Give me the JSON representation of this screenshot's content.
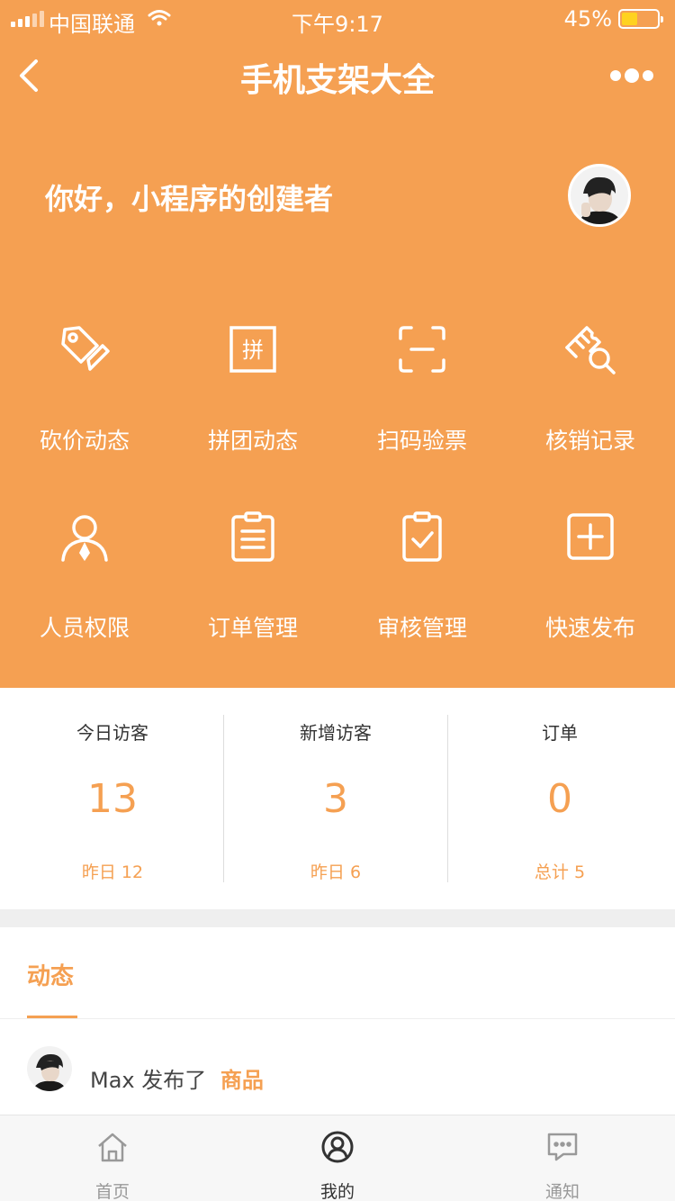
{
  "status_bar": {
    "carrier": "中国联通",
    "time": "下午9:17",
    "battery": "45%",
    "battery_level": 0.45
  },
  "nav": {
    "title": "手机支架大全"
  },
  "greeting": "你好，小程序的创建者",
  "grid": [
    {
      "label": "砍价动态",
      "icon": "tag-icon"
    },
    {
      "label": "拼团动态",
      "icon": "group-buy-icon"
    },
    {
      "label": "扫码验票",
      "icon": "scan-icon"
    },
    {
      "label": "核销记录",
      "icon": "ticket-search-icon"
    },
    {
      "label": "人员权限",
      "icon": "person-icon"
    },
    {
      "label": "订单管理",
      "icon": "order-list-icon"
    },
    {
      "label": "审核管理",
      "icon": "clipboard-check-icon"
    },
    {
      "label": "快速发布",
      "icon": "add-square-icon"
    }
  ],
  "stats": [
    {
      "label": "今日访客",
      "value": "13",
      "sub": "昨日 12"
    },
    {
      "label": "新增访客",
      "value": "3",
      "sub": "昨日 6"
    },
    {
      "label": "订单",
      "value": "0",
      "sub": "总计 5"
    }
  ],
  "activity": {
    "tab": "动态",
    "user": "Max",
    "action": "发布了",
    "target": "商品"
  },
  "tabbar": [
    {
      "label": "首页",
      "icon": "home-icon"
    },
    {
      "label": "我的",
      "icon": "profile-icon"
    },
    {
      "label": "通知",
      "icon": "message-icon"
    }
  ],
  "colors": {
    "primary": "#F5A052",
    "battery": "#FFD21F"
  }
}
